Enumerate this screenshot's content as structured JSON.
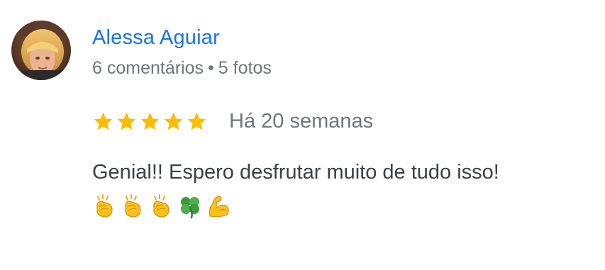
{
  "review": {
    "author": {
      "name": "Alessa Aguiar",
      "comments": "6 comentários",
      "separator": "•",
      "photos": "5 fotos"
    },
    "rating": 5,
    "rating_max": 5,
    "date": "Há 20 semanas",
    "text": "Genial!! Espero desfrutar muito de tudo isso!",
    "emojis": [
      "clapping-hands",
      "clapping-hands",
      "clapping-hands",
      "four-leaf-clover",
      "flexed-biceps"
    ]
  },
  "colors": {
    "author_name": "#1a73e8",
    "meta": "#70757a",
    "star": "#fbbc04",
    "text": "#3c4043"
  }
}
